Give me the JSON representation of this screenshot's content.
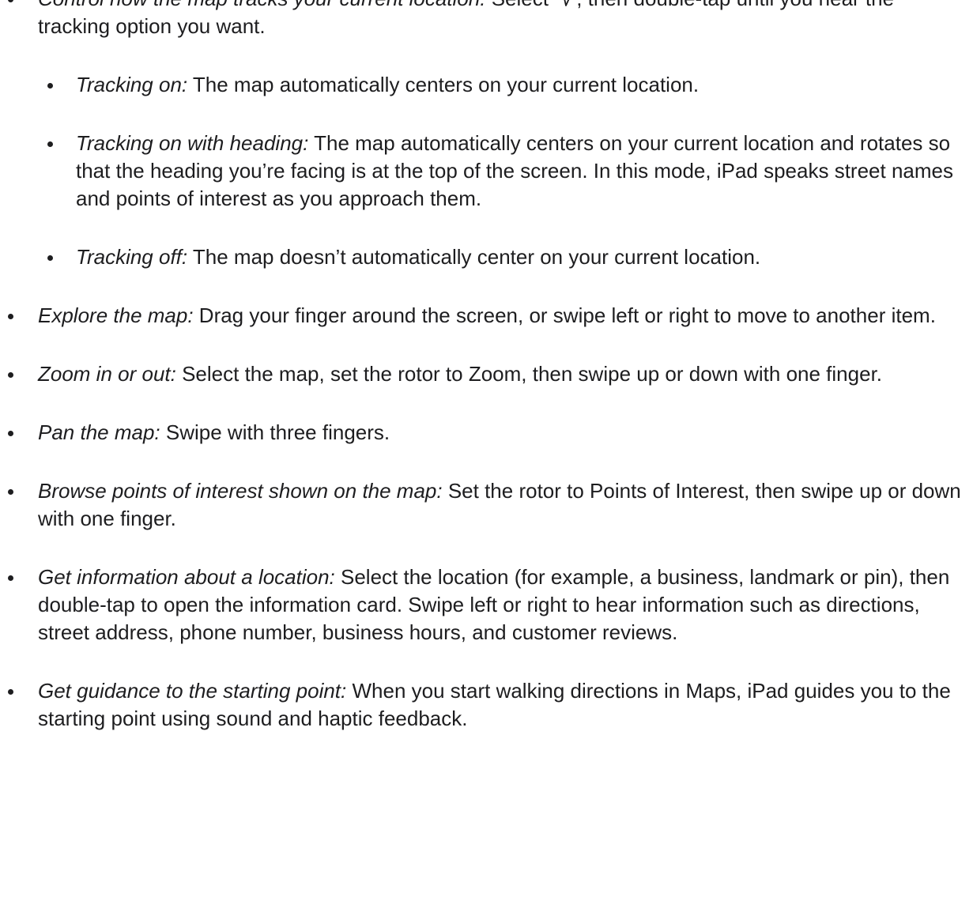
{
  "items": [
    {
      "term": "Control how the map tracks your current location:",
      "text_before_icon": " Select ",
      "icon": "location-arrow-icon",
      "text_after_icon": ", then double-tap until you hear the tracking option you want.",
      "sub_items": [
        {
          "term": "Tracking on:",
          "text": " The map automatically centers on your current location."
        },
        {
          "term": "Tracking on with heading:",
          "text": " The map automatically centers on your current location and rotates so that the heading you’re facing is at the top of the screen. In this mode, iPad speaks street names and points of interest as you approach them."
        },
        {
          "term": "Tracking off:",
          "text": " The map doesn’t automatically center on your current location."
        }
      ]
    },
    {
      "term": "Explore the map:",
      "text": " Drag your finger around the screen, or swipe left or right to move to another item."
    },
    {
      "term": "Zoom in or out:",
      "text": " Select the map, set the rotor to Zoom, then swipe up or down with one finger."
    },
    {
      "term": "Pan the map:",
      "text": " Swipe with three fingers."
    },
    {
      "term": "Browse points of interest shown on the map:",
      "text": " Set the rotor to Points of Interest, then swipe up or down with one finger."
    },
    {
      "term": "Get information about a location:",
      "text": " Select the location (for example, a business, landmark or pin), then double-tap to open the information card. Swipe left or right to hear information such as directions, street address, phone number, business hours, and customer reviews."
    },
    {
      "term": "Get guidance to the starting point:",
      "text": " When you start walking directions in Maps, iPad guides you to the starting point using sound and haptic feedback."
    }
  ]
}
